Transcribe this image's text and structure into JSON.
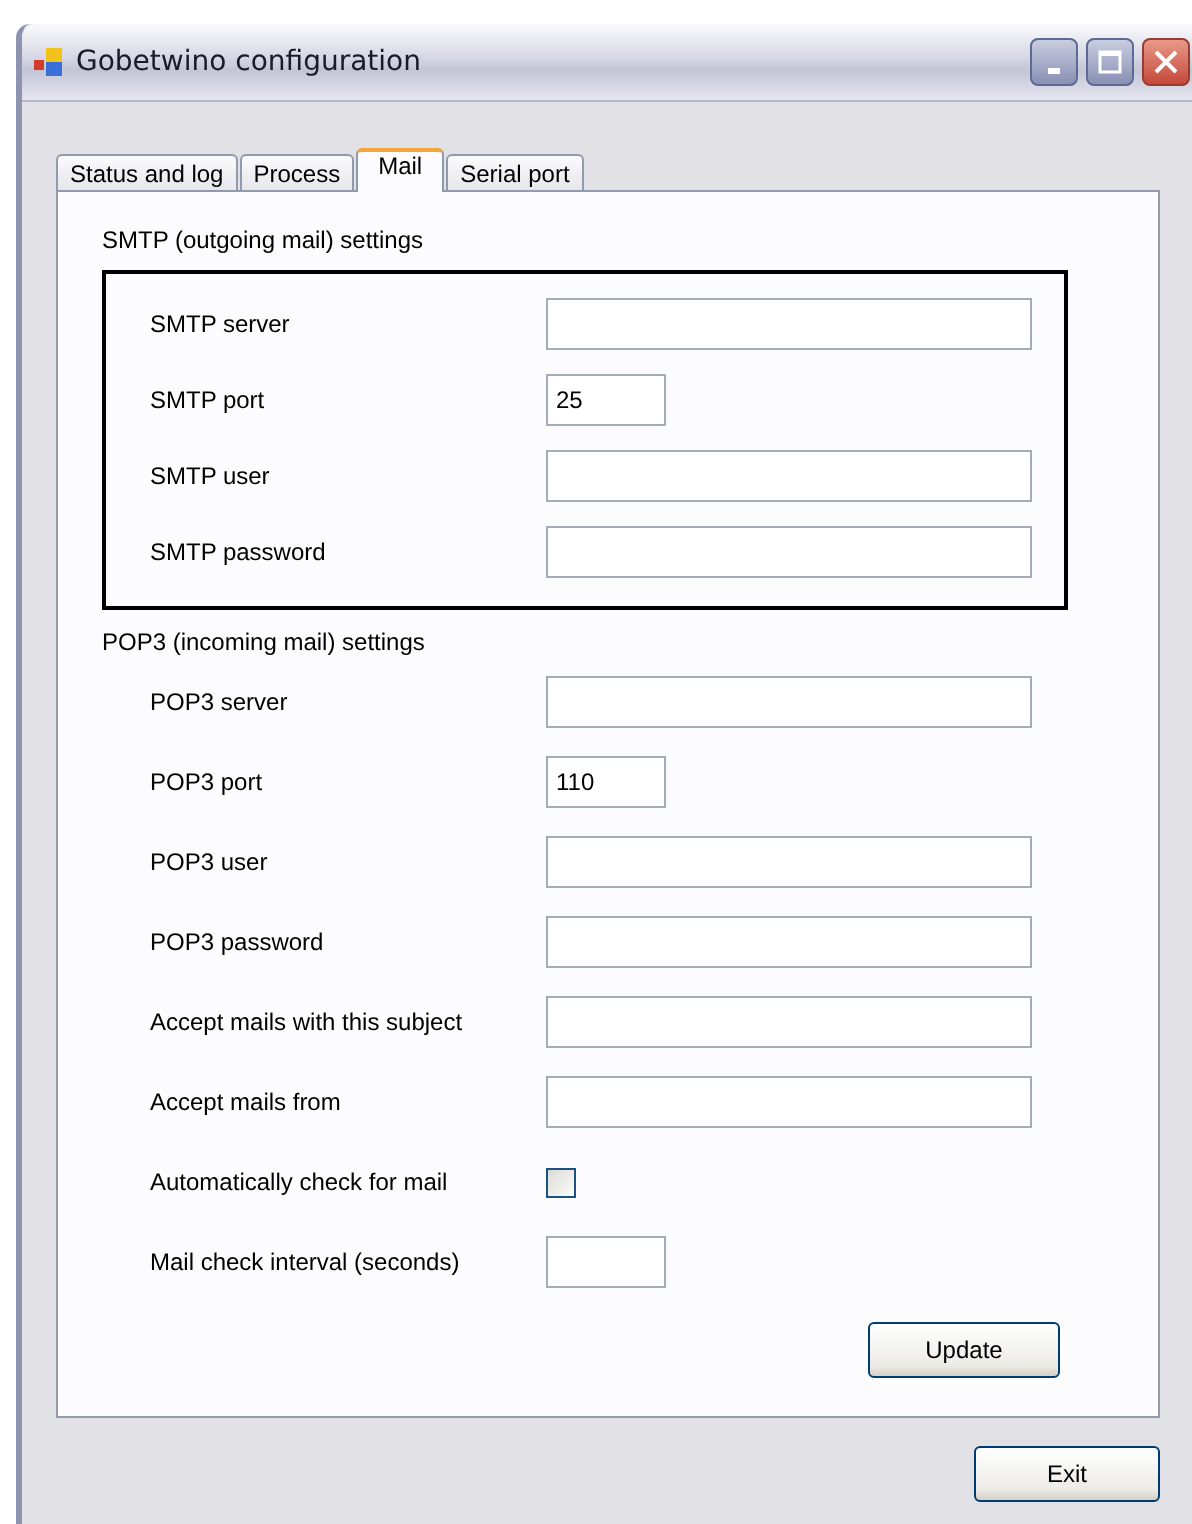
{
  "window": {
    "title": "Gobetwino configuration"
  },
  "tabs": [
    {
      "label": "Status and log",
      "selected": false
    },
    {
      "label": "Process",
      "selected": false
    },
    {
      "label": "Mail",
      "selected": true
    },
    {
      "label": "Serial port",
      "selected": false
    }
  ],
  "smtp": {
    "title": "SMTP (outgoing mail) settings",
    "rows": [
      {
        "kind": "text",
        "label": "SMTP server",
        "value": ""
      },
      {
        "kind": "number",
        "label": "SMTP port",
        "value": "25"
      },
      {
        "kind": "text",
        "label": "SMTP user",
        "value": ""
      },
      {
        "kind": "text",
        "label": "SMTP password",
        "value": ""
      }
    ]
  },
  "pop3": {
    "title": "POP3 (incoming mail) settings",
    "rows": [
      {
        "kind": "text",
        "label": "POP3 server",
        "value": ""
      },
      {
        "kind": "number",
        "label": "POP3 port",
        "value": "110"
      },
      {
        "kind": "text",
        "label": "POP3 user",
        "value": ""
      },
      {
        "kind": "text",
        "label": "POP3 password",
        "value": ""
      },
      {
        "kind": "text",
        "label": "Accept mails with this subject",
        "value": ""
      },
      {
        "kind": "text",
        "label": "Accept mails from",
        "value": ""
      },
      {
        "kind": "checkbox",
        "label": "Automatically check for mail",
        "checked": false
      },
      {
        "kind": "number",
        "label": "Mail check interval (seconds)",
        "value": ""
      }
    ]
  },
  "update_button": "Update",
  "exit_button": "Exit"
}
